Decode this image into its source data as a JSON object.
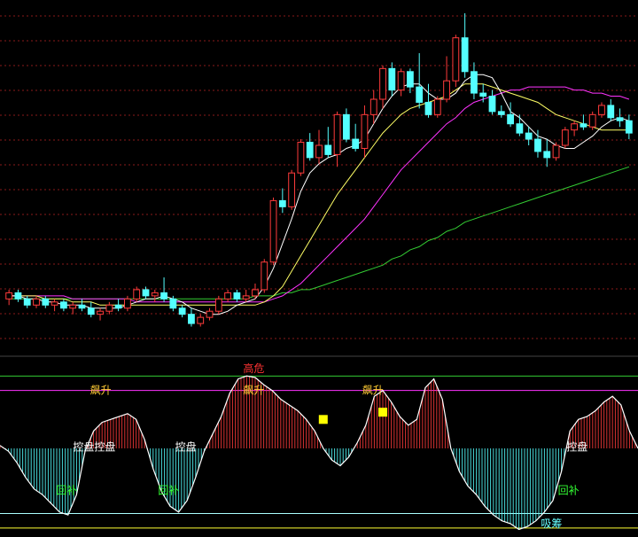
{
  "colors": {
    "up": "#ff3b3b",
    "down": "#54ffff",
    "ma5": "#ffffff",
    "ma10": "#ffff66",
    "ma20": "#ff33ff",
    "ma60": "#33cc33",
    "grid": "#8a1a1a",
    "osc": "#ffffff",
    "line_top": "#33cc33",
    "line_mid": "#ff33ff",
    "line_low": "#aaffff",
    "line_bottom": "#ffff33",
    "marker": "#ffff00",
    "label_yellow": "#ffcc33",
    "label_white": "#ffffff",
    "label_green": "#33ff33",
    "label_cyan": "#66ffff",
    "label_red": "#ff3333"
  },
  "chart_data": [
    {
      "type": "candlestick",
      "title": "",
      "xlabel": "",
      "ylabel": "",
      "grid": true,
      "ylim": [
        0,
        100
      ],
      "candles": [
        {
          "o": 20,
          "h": 23,
          "l": 18,
          "c": 22
        },
        {
          "o": 22,
          "h": 23,
          "l": 19,
          "c": 20
        },
        {
          "o": 20,
          "h": 21,
          "l": 17,
          "c": 18
        },
        {
          "o": 18,
          "h": 21,
          "l": 17,
          "c": 20
        },
        {
          "o": 20,
          "h": 21,
          "l": 17,
          "c": 18
        },
        {
          "o": 18,
          "h": 20,
          "l": 16,
          "c": 19
        },
        {
          "o": 19,
          "h": 20,
          "l": 16,
          "c": 17
        },
        {
          "o": 17,
          "h": 19,
          "l": 15,
          "c": 18
        },
        {
          "o": 18,
          "h": 20,
          "l": 16,
          "c": 17
        },
        {
          "o": 17,
          "h": 19,
          "l": 14,
          "c": 15
        },
        {
          "o": 15,
          "h": 17,
          "l": 13,
          "c": 16
        },
        {
          "o": 16,
          "h": 19,
          "l": 15,
          "c": 18
        },
        {
          "o": 18,
          "h": 20,
          "l": 16,
          "c": 17
        },
        {
          "o": 17,
          "h": 21,
          "l": 16,
          "c": 20
        },
        {
          "o": 20,
          "h": 24,
          "l": 19,
          "c": 23
        },
        {
          "o": 23,
          "h": 24,
          "l": 20,
          "c": 21
        },
        {
          "o": 21,
          "h": 23,
          "l": 19,
          "c": 22
        },
        {
          "o": 22,
          "h": 27,
          "l": 19,
          "c": 20
        },
        {
          "o": 20,
          "h": 21,
          "l": 16,
          "c": 17
        },
        {
          "o": 17,
          "h": 18,
          "l": 14,
          "c": 15
        },
        {
          "o": 15,
          "h": 17,
          "l": 11,
          "c": 12
        },
        {
          "o": 12,
          "h": 15,
          "l": 11,
          "c": 14
        },
        {
          "o": 14,
          "h": 17,
          "l": 13,
          "c": 16
        },
        {
          "o": 16,
          "h": 21,
          "l": 15,
          "c": 20
        },
        {
          "o": 20,
          "h": 23,
          "l": 19,
          "c": 22
        },
        {
          "o": 22,
          "h": 23,
          "l": 19,
          "c": 20
        },
        {
          "o": 20,
          "h": 23,
          "l": 19,
          "c": 21
        },
        {
          "o": 21,
          "h": 25,
          "l": 20,
          "c": 23
        },
        {
          "o": 23,
          "h": 33,
          "l": 22,
          "c": 32
        },
        {
          "o": 32,
          "h": 53,
          "l": 31,
          "c": 52
        },
        {
          "o": 52,
          "h": 56,
          "l": 48,
          "c": 50
        },
        {
          "o": 50,
          "h": 62,
          "l": 49,
          "c": 61
        },
        {
          "o": 61,
          "h": 72,
          "l": 60,
          "c": 71
        },
        {
          "o": 71,
          "h": 74,
          "l": 65,
          "c": 66
        },
        {
          "o": 66,
          "h": 75,
          "l": 64,
          "c": 70
        },
        {
          "o": 70,
          "h": 76,
          "l": 66,
          "c": 67
        },
        {
          "o": 67,
          "h": 81,
          "l": 63,
          "c": 80
        },
        {
          "o": 80,
          "h": 82,
          "l": 71,
          "c": 72
        },
        {
          "o": 72,
          "h": 77,
          "l": 68,
          "c": 69
        },
        {
          "o": 69,
          "h": 83,
          "l": 66,
          "c": 80
        },
        {
          "o": 80,
          "h": 88,
          "l": 77,
          "c": 85
        },
        {
          "o": 85,
          "h": 96,
          "l": 82,
          "c": 95
        },
        {
          "o": 95,
          "h": 97,
          "l": 86,
          "c": 88
        },
        {
          "o": 88,
          "h": 95,
          "l": 86,
          "c": 94
        },
        {
          "o": 94,
          "h": 95,
          "l": 87,
          "c": 89
        },
        {
          "o": 89,
          "h": 100,
          "l": 82,
          "c": 84
        },
        {
          "o": 84,
          "h": 90,
          "l": 79,
          "c": 80
        },
        {
          "o": 80,
          "h": 86,
          "l": 79,
          "c": 85
        },
        {
          "o": 85,
          "h": 99,
          "l": 84,
          "c": 91
        },
        {
          "o": 91,
          "h": 106,
          "l": 89,
          "c": 105
        },
        {
          "o": 105,
          "h": 113,
          "l": 92,
          "c": 94
        },
        {
          "o": 94,
          "h": 97,
          "l": 85,
          "c": 87
        },
        {
          "o": 87,
          "h": 90,
          "l": 84,
          "c": 86
        },
        {
          "o": 86,
          "h": 88,
          "l": 80,
          "c": 81
        },
        {
          "o": 81,
          "h": 83,
          "l": 79,
          "c": 80
        },
        {
          "o": 80,
          "h": 84,
          "l": 76,
          "c": 77
        },
        {
          "o": 77,
          "h": 80,
          "l": 73,
          "c": 74
        },
        {
          "o": 74,
          "h": 76,
          "l": 70,
          "c": 72
        },
        {
          "o": 72,
          "h": 75,
          "l": 66,
          "c": 68
        },
        {
          "o": 68,
          "h": 72,
          "l": 63,
          "c": 66
        },
        {
          "o": 66,
          "h": 71,
          "l": 65,
          "c": 70
        },
        {
          "o": 70,
          "h": 76,
          "l": 69,
          "c": 75
        },
        {
          "o": 75,
          "h": 78,
          "l": 73,
          "c": 77
        },
        {
          "o": 77,
          "h": 80,
          "l": 75,
          "c": 76
        },
        {
          "o": 76,
          "h": 81,
          "l": 75,
          "c": 80
        },
        {
          "o": 80,
          "h": 84,
          "l": 79,
          "c": 83
        },
        {
          "o": 83,
          "h": 85,
          "l": 78,
          "c": 79
        },
        {
          "o": 79,
          "h": 82,
          "l": 76,
          "c": 78
        },
        {
          "o": 78,
          "h": 80,
          "l": 72,
          "c": 74
        }
      ],
      "ma5": [
        21,
        21,
        20,
        20,
        19,
        19,
        18,
        18,
        18,
        17,
        17,
        17,
        17,
        18,
        19,
        20,
        20,
        21,
        20,
        19,
        17,
        16,
        15,
        15,
        16,
        18,
        19,
        20,
        24,
        30,
        38,
        46,
        55,
        61,
        64,
        66,
        67,
        69,
        70,
        72,
        77,
        82,
        86,
        89,
        90,
        90,
        87,
        85,
        85,
        87,
        91,
        93,
        93,
        92,
        87,
        81,
        79,
        76,
        73,
        72,
        70,
        69,
        69,
        71,
        73,
        76,
        78,
        79,
        78
      ],
      "ma10": [
        21,
        21,
        21,
        21,
        20,
        20,
        20,
        19,
        19,
        19,
        18,
        18,
        18,
        18,
        18,
        18,
        18,
        18,
        18,
        18,
        18,
        18,
        18,
        18,
        18,
        18,
        18,
        18,
        19,
        21,
        24,
        29,
        34,
        39,
        44,
        49,
        54,
        58,
        62,
        66,
        70,
        74,
        77,
        80,
        82,
        83,
        84,
        85,
        86,
        88,
        90,
        90,
        90,
        89,
        88,
        87,
        86,
        85,
        84,
        82,
        80,
        79,
        78,
        77,
        76,
        75,
        75,
        75,
        75
      ],
      "ma20": [
        21,
        21,
        21,
        21,
        21,
        21,
        21,
        20,
        20,
        20,
        20,
        20,
        20,
        20,
        19,
        19,
        19,
        19,
        19,
        19,
        19,
        19,
        19,
        19,
        19,
        19,
        19,
        19,
        19,
        20,
        21,
        23,
        25,
        28,
        31,
        34,
        37,
        40,
        43,
        46,
        50,
        54,
        58,
        62,
        65,
        68,
        71,
        74,
        77,
        79,
        82,
        84,
        85,
        86,
        87,
        88,
        88,
        89,
        89,
        89,
        89,
        89,
        88,
        88,
        87,
        87,
        86,
        86,
        85
      ],
      "ma60": [
        20,
        20,
        20,
        20,
        20,
        20,
        20,
        20,
        20,
        20,
        20,
        20,
        20,
        20,
        20,
        20,
        20,
        20,
        20,
        20,
        20,
        20,
        20,
        20,
        20,
        20,
        20,
        21,
        21,
        21,
        22,
        22,
        23,
        23,
        24,
        25,
        26,
        27,
        28,
        29,
        30,
        31,
        33,
        34,
        36,
        37,
        39,
        40,
        42,
        43,
        45,
        46,
        47,
        48,
        49,
        50,
        51,
        52,
        53,
        54,
        55,
        56,
        57,
        58,
        59,
        60,
        61,
        62,
        63
      ]
    },
    {
      "type": "oscillator",
      "title": "",
      "ylim": [
        -10,
        110
      ],
      "levels": {
        "top": 100,
        "mid": 90,
        "low": 5,
        "bottom": -5
      },
      "pivot": 50,
      "values": [
        52,
        48,
        40,
        30,
        22,
        18,
        12,
        6,
        4,
        18,
        48,
        62,
        68,
        70,
        72,
        74,
        70,
        56,
        36,
        20,
        10,
        6,
        14,
        30,
        48,
        60,
        72,
        88,
        98,
        100,
        99,
        94,
        90,
        84,
        80,
        76,
        70,
        62,
        50,
        42,
        38,
        44,
        54,
        66,
        86,
        90,
        82,
        72,
        66,
        70,
        92,
        98,
        84,
        50,
        34,
        24,
        18,
        10,
        4,
        0,
        -2,
        -6,
        -4,
        0,
        6,
        14,
        34,
        62,
        70,
        72,
        76,
        82,
        86,
        80,
        62,
        50
      ],
      "markers": [
        {
          "index": 38,
          "value": 70
        },
        {
          "index": 45,
          "value": 75
        }
      ],
      "annotations": [
        {
          "text": "飙升",
          "index": 11,
          "value": 90,
          "color": "label_yellow"
        },
        {
          "text": "控盘控盘",
          "index": 9,
          "value": 51,
          "color": "label_white"
        },
        {
          "text": "回补",
          "index": 7,
          "value": 21,
          "color": "label_green"
        },
        {
          "text": "控盘",
          "index": 21,
          "value": 51,
          "color": "label_white"
        },
        {
          "text": "回补",
          "index": 19,
          "value": 21,
          "color": "label_green"
        },
        {
          "text": "高危",
          "index": 29,
          "value": 105,
          "color": "label_red"
        },
        {
          "text": "飙升",
          "index": 29,
          "value": 90,
          "color": "label_yellow"
        },
        {
          "text": "飙升",
          "index": 43,
          "value": 90,
          "color": "label_yellow"
        },
        {
          "text": "控盘",
          "index": 67,
          "value": 51,
          "color": "label_white"
        },
        {
          "text": "回补",
          "index": 66,
          "value": 21,
          "color": "label_green"
        },
        {
          "text": "吸筹",
          "index": 64,
          "value": -2,
          "color": "label_cyan"
        }
      ]
    }
  ]
}
